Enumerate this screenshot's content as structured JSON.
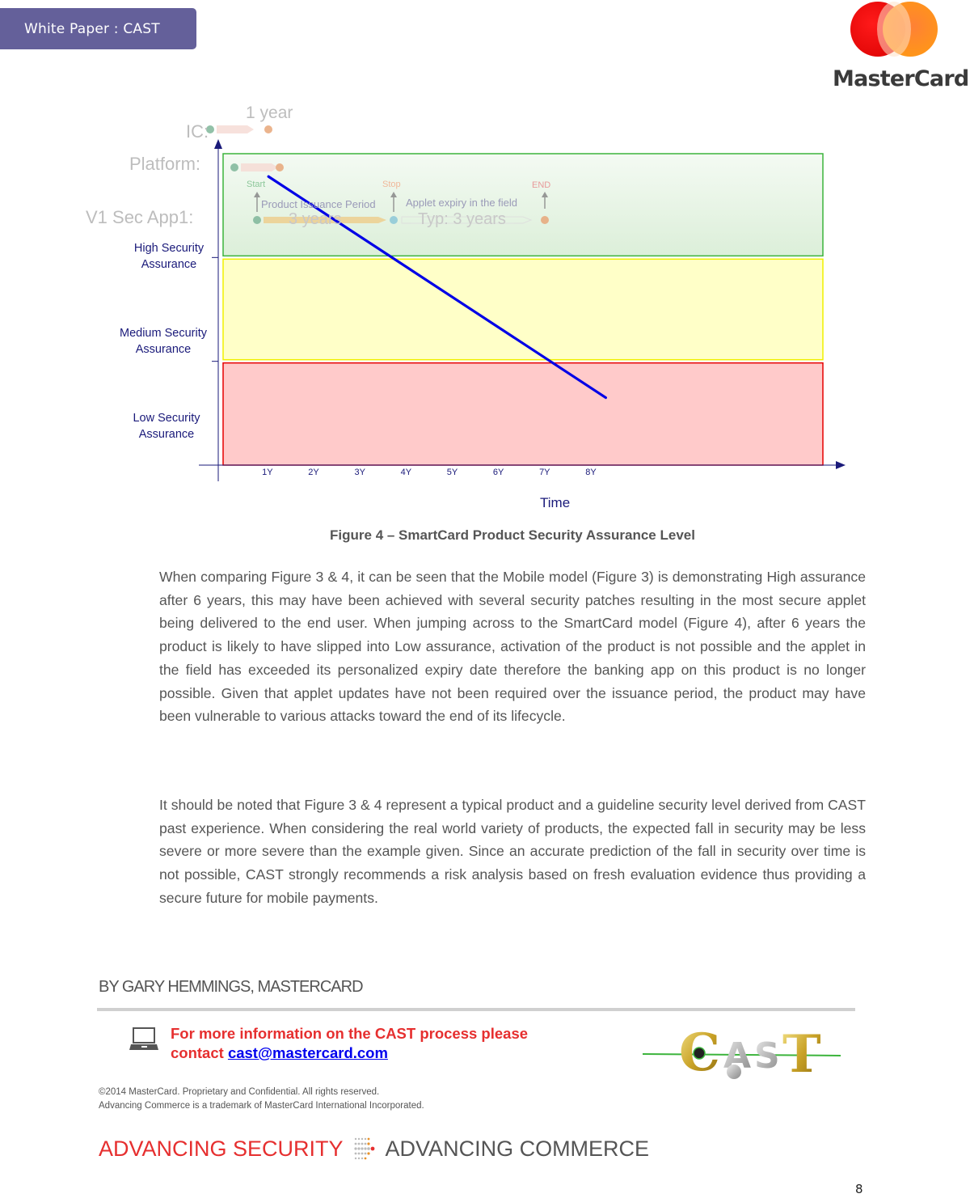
{
  "header": {
    "badge_label": "White Paper :  CAST",
    "logo_wordmark": "MasterCard"
  },
  "figure": {
    "caption": "Figure 4 – SmartCard Product Security Assurance Level",
    "background_timeline": {
      "rows": [
        "IC:",
        "Platform:",
        "V1 Sec App1:"
      ],
      "ic_period": "1 year",
      "markers": [
        "Start",
        "Stop",
        "END"
      ],
      "issuance_label": "Product Issuance Period",
      "issuance_duration": "3 years",
      "expiry_label": "Applet expiry in the field",
      "expiry_duration": "Typ: 3 years"
    }
  },
  "chart_data": {
    "type": "line",
    "title": "SmartCard Product Security Assurance Level",
    "xlabel": "Time",
    "ylabel": "",
    "x_ticks": [
      "1Y",
      "2Y",
      "3Y",
      "4Y",
      "5Y",
      "6Y",
      "7Y",
      "8Y"
    ],
    "xlim": [
      0,
      13
    ],
    "ylim": [
      0,
      3
    ],
    "grid": false,
    "bands": [
      {
        "name": "High Security Assurance",
        "label_lines": [
          "High Security",
          "Assurance"
        ],
        "range": [
          2,
          3
        ],
        "fill": "#dff0da",
        "stroke": "#3cb43c"
      },
      {
        "name": "Medium Security Assurance",
        "label_lines": [
          "Medium Security",
          "Assurance"
        ],
        "range": [
          1,
          2
        ],
        "fill": "#ffffc8",
        "stroke": "#f0f000"
      },
      {
        "name": "Low Security Assurance",
        "label_lines": [
          "Low Security",
          "Assurance"
        ],
        "range": [
          0,
          1
        ],
        "fill": "#ffcaca",
        "stroke": "#e60000"
      }
    ],
    "series": [
      {
        "name": "Security assurance",
        "color": "#0000e6",
        "x": [
          1,
          8.3
        ],
        "y": [
          2.78,
          0.65
        ]
      }
    ]
  },
  "body": {
    "paragraphs": [
      "When comparing Figure 3 & 4, it can be seen that the Mobile model (Figure 3) is demonstrating High assurance after 6 years, this may have been achieved with several security patches resulting in the most secure applet being delivered to the end user. When jumping across to the SmartCard model (Figure 4), after 6 years the product is likely to have slipped into Low assurance, activation of the product is not possible and the applet in the field has exceeded its personalized expiry date therefore the banking app on this product is no longer possible. Given that applet updates have not been required over the issuance period, the product may have been vulnerable to various attacks toward the end of its lifecycle.",
      "It should be noted that Figure 3 & 4 represent a typical product and a guideline security level derived from CAST past experience. When considering the real world variety of products, the expected fall in security may be less severe or  more severe than the example given. Since an accurate prediction of the fall in security over time is not possible, CAST strongly recommends a risk analysis based on fresh evaluation evidence thus providing a secure future for mobile payments."
    ]
  },
  "footer": {
    "byline": "BY GARY HEMMINGS, MASTERCARD",
    "info_text_1": "For more information on the CAST process please",
    "info_text_2": "contact ",
    "contact_email": "cast@mastercard.com",
    "cast_logo_text": "CAST",
    "legal_1": "©2014 MasterCard. Proprietary and Confidential. All rights reserved.",
    "legal_2": "Advancing Commerce is a trademark of MasterCard International Incorporated.",
    "slogan_left": "ADVANCING SECURITY",
    "slogan_right": "ADVANCING COMMERCE",
    "page_number": "8"
  }
}
